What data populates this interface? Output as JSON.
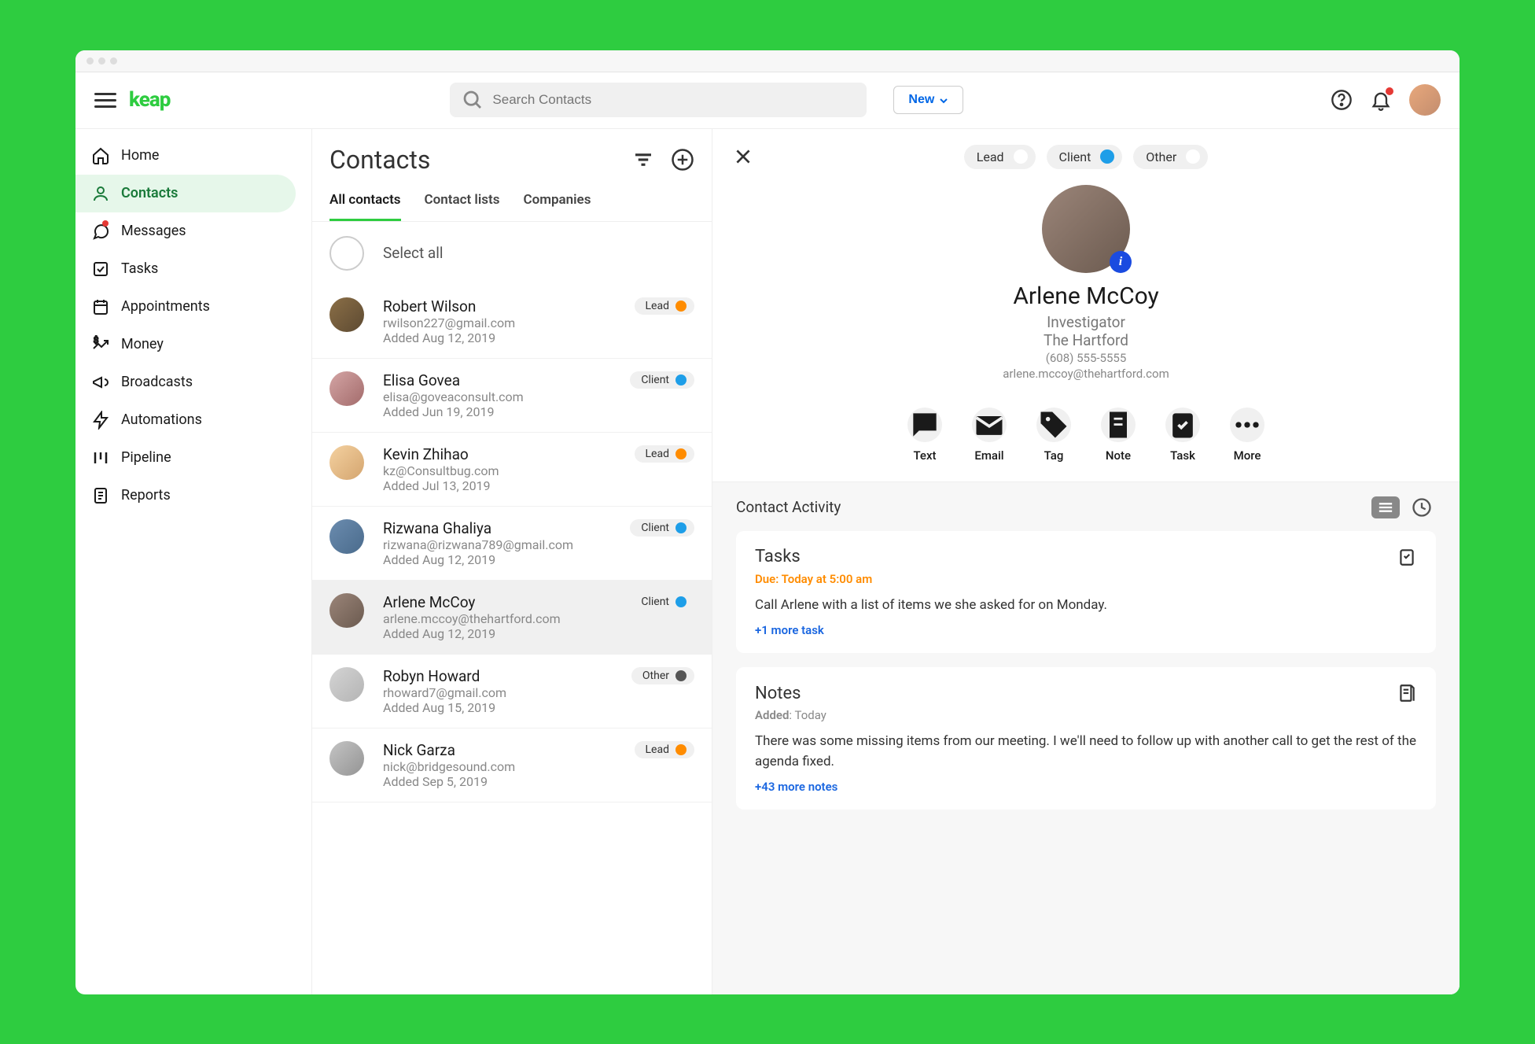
{
  "brand": "keap",
  "search": {
    "placeholder": "Search Contacts"
  },
  "new_button": "New",
  "sidebar": {
    "items": [
      {
        "label": "Home",
        "icon": "home"
      },
      {
        "label": "Contacts",
        "icon": "person",
        "active": true
      },
      {
        "label": "Messages",
        "icon": "chat",
        "dot": true
      },
      {
        "label": "Tasks",
        "icon": "check-square"
      },
      {
        "label": "Appointments",
        "icon": "calendar"
      },
      {
        "label": "Money",
        "icon": "money"
      },
      {
        "label": "Broadcasts",
        "icon": "megaphone"
      },
      {
        "label": "Automations",
        "icon": "bolt"
      },
      {
        "label": "Pipeline",
        "icon": "pipeline"
      },
      {
        "label": "Reports",
        "icon": "reports"
      }
    ]
  },
  "contacts_panel": {
    "title": "Contacts",
    "tabs": [
      "All contacts",
      "Contact lists",
      "Companies"
    ],
    "select_all": "Select all",
    "list": [
      {
        "name": "Robert Wilson",
        "email": "rwilson227@gmail.com",
        "added": "Added Aug 12, 2019",
        "badge": "Lead",
        "color": "orange"
      },
      {
        "name": "Elisa Govea",
        "email": "elisa@goveaconsult.com",
        "added": "Added Jun 19, 2019",
        "badge": "Client",
        "color": "blue"
      },
      {
        "name": "Kevin Zhihao",
        "email": "kz@Consultbug.com",
        "added": "Added Jul 13, 2019",
        "badge": "Lead",
        "color": "orange"
      },
      {
        "name": "Rizwana Ghaliya",
        "email": "rizwana@rizwana789@gmail.com",
        "added": "Added Aug 12, 2019",
        "badge": "Client",
        "color": "blue"
      },
      {
        "name": "Arlene McCoy",
        "email": "arlene.mccoy@thehartford.com",
        "added": "Added Aug 12, 2019",
        "badge": "Client",
        "color": "blue",
        "selected": true
      },
      {
        "name": "Robyn Howard",
        "email": "rhoward7@gmail.com",
        "added": "Added Aug 15, 2019",
        "badge": "Other",
        "color": "gray"
      },
      {
        "name": "Nick Garza",
        "email": "nick@bridgesound.com",
        "added": "Added Sep 5, 2019",
        "badge": "Lead",
        "color": "orange"
      }
    ]
  },
  "detail": {
    "toggles": [
      {
        "label": "Lead",
        "active": false
      },
      {
        "label": "Client",
        "active": true
      },
      {
        "label": "Other",
        "active": false
      }
    ],
    "name": "Arlene McCoy",
    "role": "Investigator",
    "company": "The Hartford",
    "phone": "(608) 555-5555",
    "email": "arlene.mccoy@thehartford.com",
    "actions": [
      "Text",
      "Email",
      "Tag",
      "Note",
      "Task",
      "More"
    ],
    "activity_title": "Contact Activity",
    "tasks_card": {
      "title": "Tasks",
      "due_label": "Due",
      "due_value": ": Today at 5:00 am",
      "body": "Call Arlene with a list of items we she asked for on Monday.",
      "more": "+1 more task"
    },
    "notes_card": {
      "title": "Notes",
      "added_label": "Added",
      "added_value": ": Today",
      "body": "There was some missing items from our meeting. I we'll need to follow up with another call to get the rest of the agenda fixed.",
      "more": "+43 more notes"
    }
  }
}
